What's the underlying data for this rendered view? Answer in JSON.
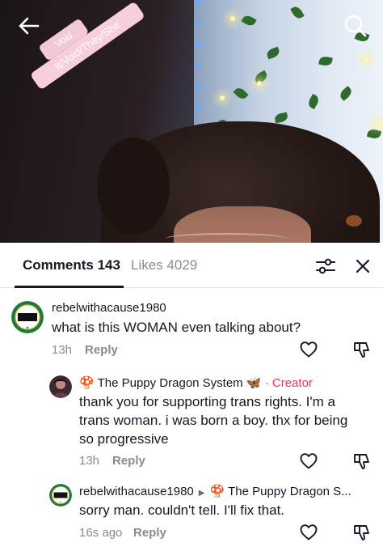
{
  "video": {
    "pronoun_sticker": {
      "top_text": "Void",
      "bottom_text": "It/Void/They/She"
    }
  },
  "tabs": {
    "comments_label": "Comments 143",
    "likes_label": "Likes 4029"
  },
  "comments": [
    {
      "username": "rebelwithacause1980",
      "text": "what is this WOMAN even talking about?",
      "timestamp": "13h",
      "reply_label": "Reply"
    },
    {
      "username": "The Puppy Dragon System",
      "butterfly": "🦋",
      "mushroom": "🍄",
      "separator": "·",
      "badge": "Creator",
      "text": "thank you for supporting trans rights. I'm a trans woman. i was born a boy. thx for being so progressive",
      "timestamp": "13h",
      "reply_label": "Reply"
    },
    {
      "username": "rebelwithacause1980",
      "reply_to_mushroom": "🍄",
      "reply_to": "The Puppy Dragon S...",
      "text": "sorry man. couldn't tell. I'll fix that.",
      "timestamp": "16s ago",
      "reply_label": "Reply"
    }
  ],
  "colors": {
    "accent": "#fe2c55",
    "secondary_text": "#8a8b91",
    "primary_text": "#161823"
  }
}
